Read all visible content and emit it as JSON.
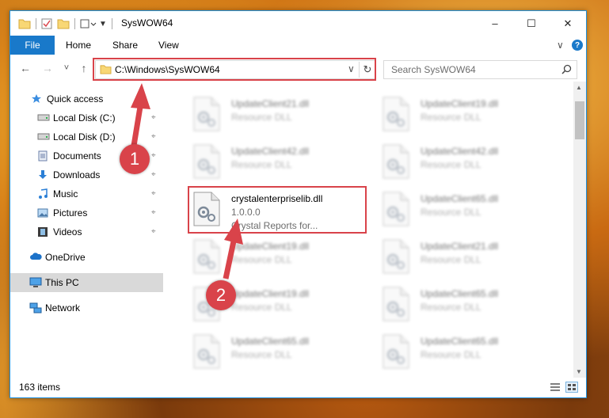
{
  "window": {
    "title": "SysWOW64",
    "min_glyph": "–",
    "max_glyph": "☐",
    "close_glyph": "✕"
  },
  "ribbon": {
    "tabs": [
      "File",
      "Home",
      "Share",
      "View"
    ],
    "chevron": "∨",
    "help": "?"
  },
  "nav": {
    "back": "←",
    "forward": "→",
    "recent": "˅",
    "up": "↑"
  },
  "address": {
    "path": "C:\\Windows\\SysWOW64",
    "dropdown": "∨",
    "refresh": "↻"
  },
  "search": {
    "placeholder": "Search SysWOW64"
  },
  "sidebar": {
    "items": [
      {
        "label": "Quick access",
        "icon": "star-icon",
        "pinned": false
      },
      {
        "label": "Local Disk (C:)",
        "icon": "drive-icon",
        "pinned": true
      },
      {
        "label": "Local Disk (D:)",
        "icon": "drive-icon",
        "pinned": true
      },
      {
        "label": "Documents",
        "icon": "documents-icon",
        "pinned": true
      },
      {
        "label": "Downloads",
        "icon": "download-icon",
        "pinned": true
      },
      {
        "label": "Music",
        "icon": "music-icon",
        "pinned": true
      },
      {
        "label": "Pictures",
        "icon": "pictures-icon",
        "pinned": true
      },
      {
        "label": "Videos",
        "icon": "videos-icon",
        "pinned": true
      },
      {
        "label": "OneDrive",
        "icon": "cloud-icon",
        "pinned": false
      },
      {
        "label": "This PC",
        "icon": "computer-icon",
        "pinned": false,
        "selected": true
      },
      {
        "label": "Network",
        "icon": "network-icon",
        "pinned": false
      }
    ]
  },
  "files": [
    {
      "name": "UpdateClient21.dll",
      "type": "Resource DLL",
      "blurred": true
    },
    {
      "name": "UpdateClient19.dll",
      "type": "Resource DLL",
      "blurred": true
    },
    {
      "name": "UpdateClient42.dll",
      "type": "Resource DLL",
      "blurred": true
    },
    {
      "name": "UpdateClient42.dll",
      "type": "Resource DLL",
      "blurred": true
    },
    {
      "name": "crystalenterpriselib.dll",
      "version": "1.0.0.0",
      "type": "Crystal Reports for...",
      "blurred": false
    },
    {
      "name": "UpdateClient65.dll",
      "type": "Resource DLL",
      "blurred": true
    },
    {
      "name": "UpdateClient19.dll",
      "type": "Resource DLL",
      "blurred": true
    },
    {
      "name": "UpdateClient21.dll",
      "type": "Resource DLL",
      "blurred": true
    },
    {
      "name": "UpdateClient19.dll",
      "type": "Resource DLL",
      "blurred": true
    },
    {
      "name": "UpdateClient65.dll",
      "type": "Resource DLL",
      "blurred": true
    },
    {
      "name": "UpdateClient65.dll",
      "type": "Resource DLL",
      "blurred": true
    },
    {
      "name": "UpdateClient65.dll",
      "type": "Resource DLL",
      "blurred": true
    }
  ],
  "status": {
    "count": "163 items"
  },
  "callouts": {
    "one": "1",
    "two": "2"
  },
  "colors": {
    "accent": "#1979ca",
    "highlight": "#d9434a",
    "selected": "#d9d9d9"
  }
}
